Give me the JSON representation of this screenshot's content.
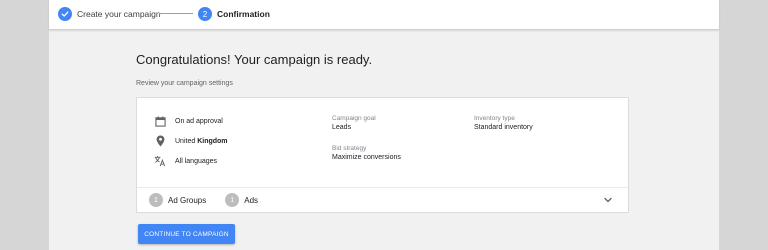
{
  "stepper": {
    "step1": {
      "label": "Create your campaign",
      "status": "complete"
    },
    "step2": {
      "number": "2",
      "label": "Confirmation",
      "status": "active"
    }
  },
  "page": {
    "title": "Congratulations! Your campaign is ready.",
    "subtitle": "Review your campaign settings"
  },
  "summary": {
    "schedule": "On ad approval",
    "location_prefix": "United ",
    "location_bold": "Kingdom",
    "languages": "All languages",
    "campaign_goal_label": "Campaign goal",
    "campaign_goal_value": "Leads",
    "bid_strategy_label": "Bid strategy",
    "bid_strategy_value": "Maximize conversions",
    "inventory_type_label": "Inventory type",
    "inventory_type_value": "Standard inventory"
  },
  "counts": {
    "ad_groups_count": "1",
    "ad_groups_label": "Ad Groups",
    "ads_count": "1",
    "ads_label": "Ads"
  },
  "cta": {
    "label": "CONTINUE TO CAMPAIGN"
  },
  "icons": {
    "check": "check-icon",
    "calendar": "calendar-icon",
    "location": "location-pin-icon",
    "language": "translate-icon",
    "chevron": "chevron-down-icon"
  },
  "colors": {
    "accent": "#4285f4",
    "muted_circle": "#bdbdbd"
  }
}
